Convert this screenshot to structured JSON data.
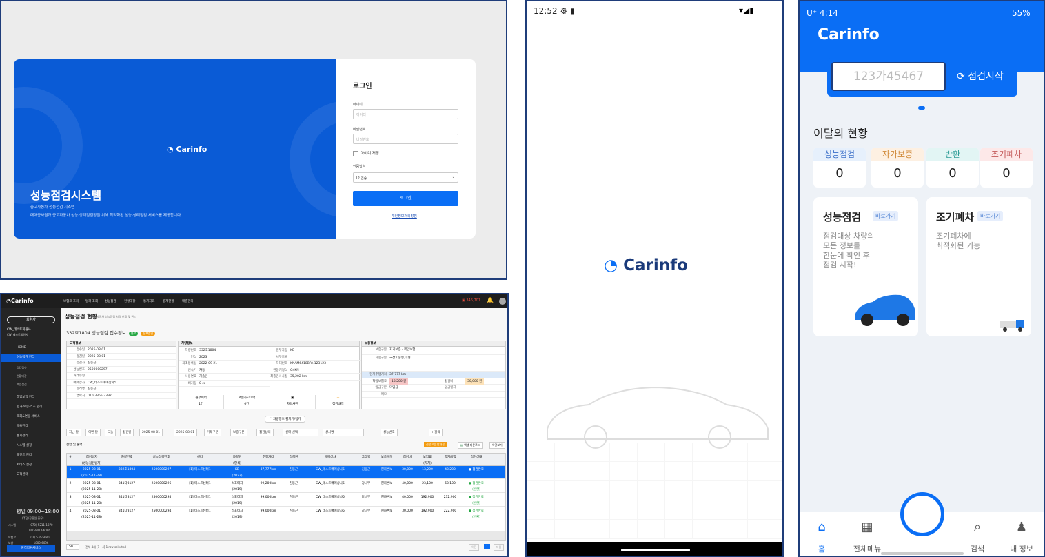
{
  "login": {
    "logo": "Carinfo",
    "system_title": "성능점검시스템",
    "system_subtitle": "중고자동차 성능점검 시스템",
    "system_desc": "매매종사원과 중고자동차 성능·상태점검장을 위해 최적화된 성능·상태점검 서비스를 제공합니다",
    "heading": "로그인",
    "id_label": "아이디",
    "id_placeholder": "아이디",
    "pw_label": "비밀번호",
    "pw_placeholder": "비밀번호",
    "remember": "아이디 저장",
    "auth_label": "인증방식",
    "auth_value": "IP 인증",
    "login_button": "로그인",
    "privacy_link": "개인정보처리방침"
  },
  "admin": {
    "logo": "Carinfo",
    "menu": [
      "보험료 조회",
      "딜러 조회",
      "성능점검",
      "현황대장",
      "통계자료",
      "결제현황",
      "매출관리"
    ],
    "alert_count": "346,701",
    "sidebar_button": "회원사",
    "company": "CW_테스트회원사",
    "company_sub": "CW_테스트회원사",
    "sidebar_items": [
      "HOME",
      "성능점검 관리",
      "책임보험 관리",
      "평가·보증·리스 관리",
      "조회&연동 서비스",
      "매출관리",
      "통계관리",
      "시스템 설정",
      "포인트 관리",
      "서비스 설정",
      "고객센터"
    ],
    "sidebar_sub": [
      "점검접수",
      "현황대장",
      "책임점검"
    ],
    "hours": "평일 09:00~18:00",
    "hours_note": "(주말/공휴일 휴무)",
    "contacts": [
      {
        "k": "시스템",
        "v": "070) 5211-1370"
      },
      {
        "k": "",
        "v": "010-9414-6096"
      },
      {
        "k": "보험료",
        "v": "02) 576-5880"
      },
      {
        "k": "보상",
        "v": "1800-6096"
      },
      {
        "k": "FAX",
        "v": "02) 575-5799"
      }
    ],
    "remote": "원격지원서비스",
    "page_title": "성능점검 현황",
    "page_sub": "자동차 성능점검 처량 현황 및 관리",
    "vehicle_header": "332호1804 성능점검 접수정보",
    "badge1": "완료",
    "badge2": "전표승인",
    "customer": {
      "title": "고객정보",
      "rows": [
        {
          "k": "접수일",
          "v": "2025-08-01"
        },
        {
          "k": "점검일",
          "v": "2025-08-01"
        },
        {
          "k": "점검자",
          "v": "김동근"
        },
        {
          "k": "성능번호",
          "v": "2500000297"
        },
        {
          "k": "거래유형",
          "v": ""
        },
        {
          "k": "매매상사",
          "v": "CW_테스트매매상사5"
        },
        {
          "k": "딜러명",
          "v": "김동근"
        },
        {
          "k": "연락처",
          "v": "010-3355-3392"
        }
      ]
    },
    "vehicle": {
      "title": "차량정보",
      "rows": [
        {
          "k": "차량번호",
          "v": "332호1804"
        },
        {
          "k": "연식",
          "v": "2023"
        },
        {
          "k": "최초등록일",
          "v": "2022-09-21"
        },
        {
          "k": "변속기",
          "v": "자동"
        },
        {
          "k": "사용연료",
          "v": "가솔린"
        },
        {
          "k": "배기량",
          "v": "0 cc"
        },
        {
          "k": "원부차량",
          "v": "KB"
        },
        {
          "k": "세부모델",
          "v": ""
        },
        {
          "k": "차대번호",
          "v": "KNAM6418BPA 123123"
        },
        {
          "k": "원동기형식",
          "v": "G4KN"
        },
        {
          "k": "최종검사사정",
          "v": "35,202 km"
        }
      ]
    },
    "insurance": {
      "title": "보증정보",
      "rows": [
        {
          "k": "보증구분",
          "v": "자기보증 · 책임보험"
        },
        {
          "k": "차종구분",
          "v": "국산 / 중형,대형"
        },
        {
          "k": "현재주행거리",
          "v": "37,777 km"
        },
        {
          "k": "책임보험료",
          "v": "13,200 원"
        },
        {
          "k": "입금구분",
          "v": "미입금"
        },
        {
          "k": "메모",
          "v": ""
        }
      ],
      "check_fee": "30,000 원",
      "check_fee_label": "점검비",
      "deposit_label": "입금일자"
    },
    "link_labels": [
      "원부이력",
      "보험사고이력",
      "차량사진",
      "점검내역"
    ],
    "link_values": [
      "1건",
      "0건"
    ],
    "toggle": "차량정보 펼치기/접기",
    "filters": [
      "지난 달",
      "이번 달",
      "오늘",
      "점검일",
      "2025-08-01",
      "2025-08-01",
      "거래구분",
      "보증구분",
      "점검상태",
      "센터 선택",
      "상사명",
      "성능번호",
      "검색"
    ],
    "actions": [
      "전문보증 안내문",
      "엑셀 다운로드",
      "약관보기"
    ],
    "output": "결합 및 출력",
    "columns": [
      "#",
      "점검일자\n(성능점검일자)",
      "차량번호",
      "성능점검번호",
      "센터",
      "차량명\n(연식)",
      "주행거리",
      "점검원",
      "매매상사",
      "고객명",
      "보증구분",
      "점검비",
      "보험료\n(자차)",
      "합계금액",
      "점검상태"
    ],
    "rows": [
      [
        "1",
        "2025-08-01\n(2025-11-28)",
        "332호1804",
        "2500000297",
        "[1] 테스트센터1",
        "KB\n(2023)",
        "37,777km",
        "김동근",
        "CW_테스트매매상사5",
        "김동근",
        "현화손보",
        "30,000",
        "13,200",
        "43,200",
        "● 점검완료"
      ],
      [
        "2",
        "2025-08-01\n(2025-11-28)",
        "341다8127",
        "2500000296",
        "[1] 테스트센터1",
        "스포티지\n(2019)",
        "99,200km",
        "김동근",
        "CW_테스트매매상사5",
        "강나무",
        "현화손보",
        "40,000",
        "23,100",
        "63,100",
        "● 점검완료\n(반환)"
      ],
      [
        "3",
        "2025-08-01\n(2025-11-28)",
        "341다8127",
        "2500000295",
        "[1] 테스트센터1",
        "스포티지\n(2019)",
        "99,000km",
        "김동근",
        "CW_테스트매매상사5",
        "강나무",
        "현화손보",
        "40,000",
        "192,900",
        "232,900",
        "● 점검완료\n(반환)"
      ],
      [
        "4",
        "2025-08-01\n(2025-11-28)",
        "341다8127",
        "2500000294",
        "[1] 테스트센터1",
        "스포티지\n(2019)",
        "99,000km",
        "김동근",
        "CW_테스트매매상사5",
        "강나무",
        "현화손보",
        "30,000",
        "192,900",
        "222,900",
        "● 점검완료\n(반환)"
      ]
    ],
    "page_size": "50",
    "pager_text": "전체 4개 [1 - 4]   1 row selected",
    "pager_prev": "이전",
    "pager_page": "1",
    "pager_next": "다음"
  },
  "splash": {
    "time": "12:52",
    "logo": "Carinfo"
  },
  "mobile": {
    "status": "U⁺ 4:14",
    "battery": "55%",
    "logo": "Carinfo",
    "plate": "123가45467",
    "start": "점검시작",
    "month_title": "이달의 현황",
    "stats": [
      {
        "label": "성능점검",
        "value": "0",
        "color": "#e6f0fc",
        "fg": "#3a6fc8"
      },
      {
        "label": "자가보증",
        "value": "0",
        "color": "#fdf0e2",
        "fg": "#d08a3a"
      },
      {
        "label": "반환",
        "value": "0",
        "color": "#e2f5f4",
        "fg": "#2e9d97"
      },
      {
        "label": "조기폐차",
        "value": "0",
        "color": "#fde8e8",
        "fg": "#c45a5a"
      }
    ],
    "card1": {
      "title": "성능점검",
      "badge": "바로가기",
      "desc1": "점검대상 차량의",
      "desc2": "모든 정보를",
      "desc3": "한눈에 확인 후",
      "desc4": "점검 시작!"
    },
    "card2": {
      "title": "조기폐차",
      "badge": "바로가기",
      "desc1": "조기폐차에",
      "desc2": "최적화된 기능"
    },
    "nav": [
      "홈",
      "전체메뉴",
      "검색",
      "내 정보"
    ]
  }
}
